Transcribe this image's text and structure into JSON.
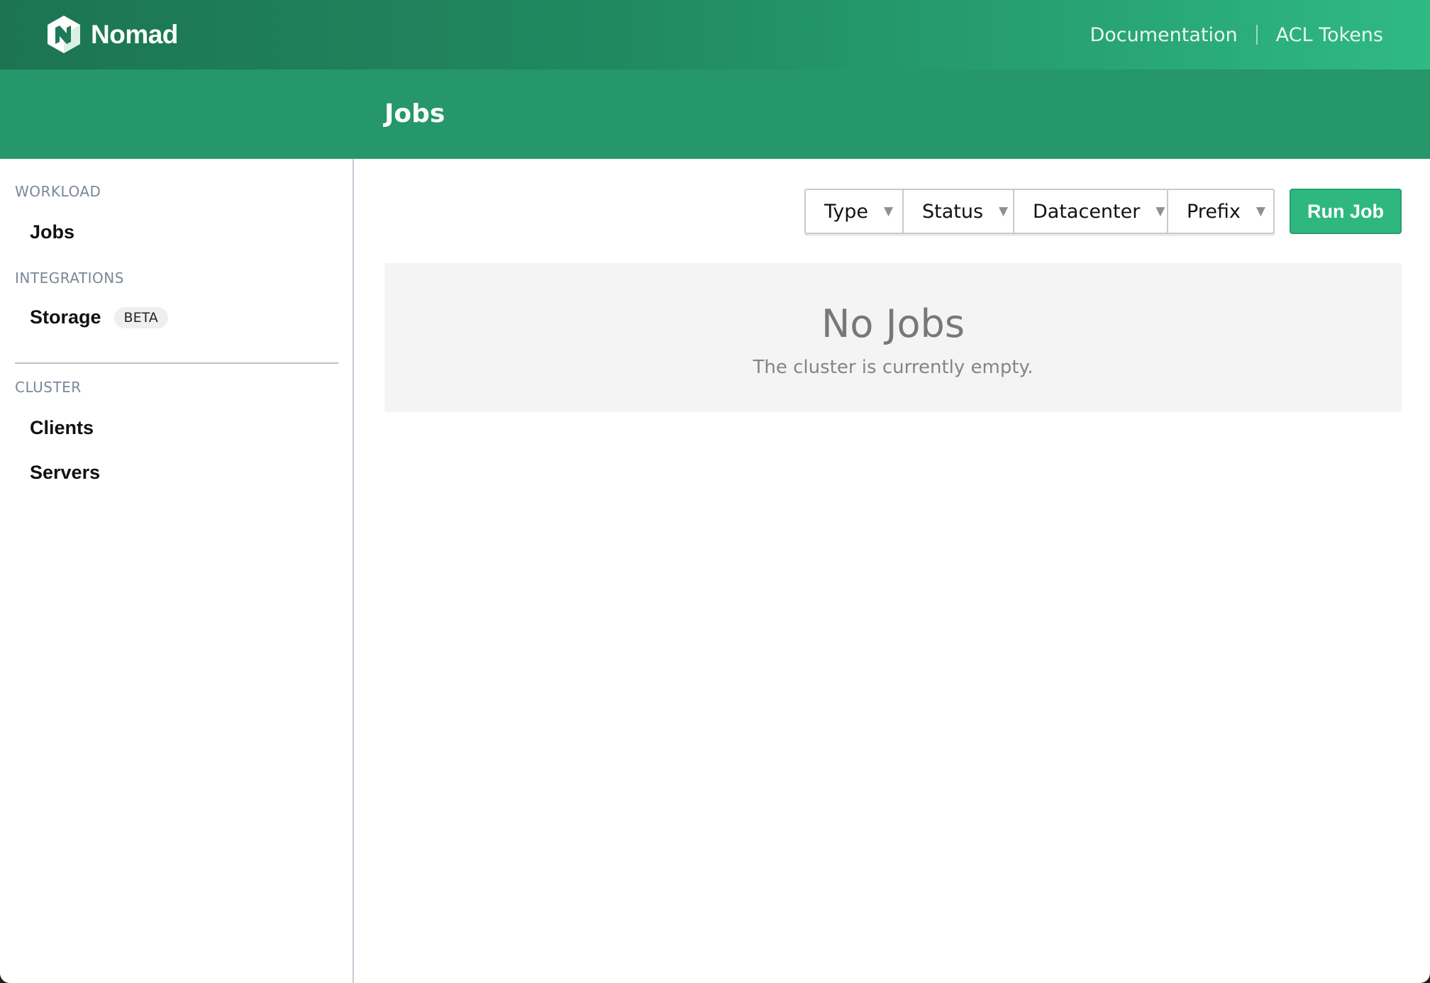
{
  "navbar": {
    "brand": "Nomad",
    "links": [
      "Documentation",
      "ACL Tokens"
    ]
  },
  "page": {
    "title": "Jobs"
  },
  "sidebar": {
    "workload_label": "WORKLOAD",
    "jobs": "Jobs",
    "integrations_label": "INTEGRATIONS",
    "storage": "Storage",
    "storage_badge": "BETA",
    "cluster_label": "CLUSTER",
    "clients": "Clients",
    "servers": "Servers"
  },
  "filters": [
    {
      "label": "Type"
    },
    {
      "label": "Status"
    },
    {
      "label": "Datacenter"
    },
    {
      "label": "Prefix"
    }
  ],
  "actions": {
    "run_job": "Run Job"
  },
  "empty_state": {
    "title": "No Jobs",
    "message": "The cluster is currently empty."
  },
  "colors": {
    "brand_green": "#25976a",
    "button_green": "#2eb87f"
  }
}
